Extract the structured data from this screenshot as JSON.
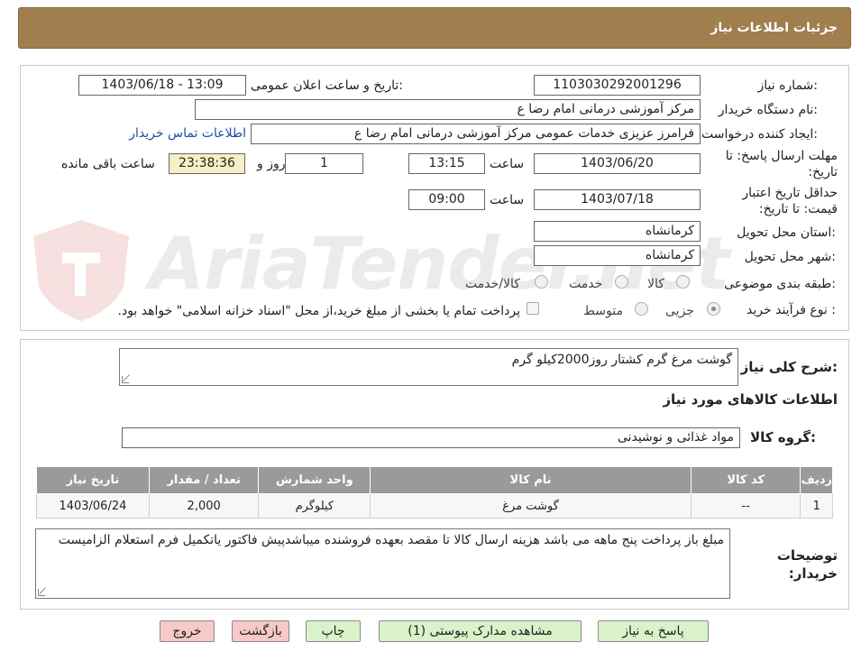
{
  "header": {
    "title": "جزئیات اطلاعات نیاز"
  },
  "form": {
    "need_number_label": "شماره نیاز:",
    "need_number": "1103030292001296",
    "announce_label": "تاریخ و ساعت اعلان عمومی:",
    "announce_value": "1403/06/18 - 13:09",
    "buyer_org_label": "نام دستگاه خریدار:",
    "buyer_org": "مرکز آموزشی  درمانی امام رضا  ع",
    "requester_label": "ایجاد کننده درخواست:",
    "requester": "فرامرز عزیزی خدمات عمومی مرکز آموزشی  درمانی امام رضا  ع",
    "contact_link": "اطلاعات تماس خریدار",
    "deadline_label": "مهلت ارسال پاسخ: تا تاریخ:",
    "deadline_date": "1403/06/20",
    "time_label": "ساعت",
    "deadline_time": "13:15",
    "days": "1",
    "days_label": "روز و",
    "remaining": "23:38:36",
    "remaining_label": "ساعت باقی مانده",
    "price_validity_label": "حداقل تاریخ اعتبار قیمت: تا تاریخ:",
    "price_validity_date": "1403/07/18",
    "price_validity_time": "09:00",
    "province_label": "استان محل تحویل:",
    "province": "کرمانشاه",
    "city_label": "شهر محل تحویل:",
    "city": "کرمانشاه",
    "category_label": "طبقه بندی موضوعی:",
    "category_options": [
      "کالا",
      "خدمت",
      "کالا/خدمت"
    ],
    "process_label": "نوع فرآیند خرید :",
    "process_options": [
      "جزیی",
      "متوسط"
    ],
    "payment_note": "پرداخت تمام یا بخشی از مبلغ خرید،از محل \"اسناد خزانه اسلامی\" خواهد بود."
  },
  "details": {
    "summary_label": "شرح کلی نیاز:",
    "summary": "گوشت مرغ گرم کشتار روز2000کیلو گرم",
    "goods_info_title": "اطلاعات کالاهای مورد نیاز",
    "goods_group_label": "گروه کالا:",
    "goods_group": "مواد غذائی و نوشیدنی",
    "table_headers": [
      "ردیف",
      "کد کالا",
      "نام کالا",
      "واحد شمارش",
      "تعداد / مقدار",
      "تاریخ نیاز"
    ],
    "table_rows": [
      [
        "1",
        "--",
        "گوشت مرغ",
        "کیلوگرم",
        "2,000",
        "1403/06/24"
      ]
    ],
    "buyer_notes_label": "توضیحات خریدار:",
    "buyer_notes": "مبلغ باز پرداخت پنج ماهه می باشد هزینه ارسال کالا تا مقصد بعهده فروشنده میباشدپیش فاکتور یاتکمیل فرم استعلام الزامیست"
  },
  "buttons": {
    "reply": "پاسخ به نیاز",
    "attachments": "مشاهده مدارک پیوستی (1)",
    "print": "چاپ",
    "back": "بازگشت",
    "exit": "خروج"
  },
  "watermark": {
    "text": "AriaTender.net"
  },
  "colors": {
    "header": "#a07e4e",
    "table_header": "#9a9a9a",
    "button_green": "#d9f2c9",
    "button_pink": "#f7c9c9",
    "link": "#1f4ea3"
  }
}
